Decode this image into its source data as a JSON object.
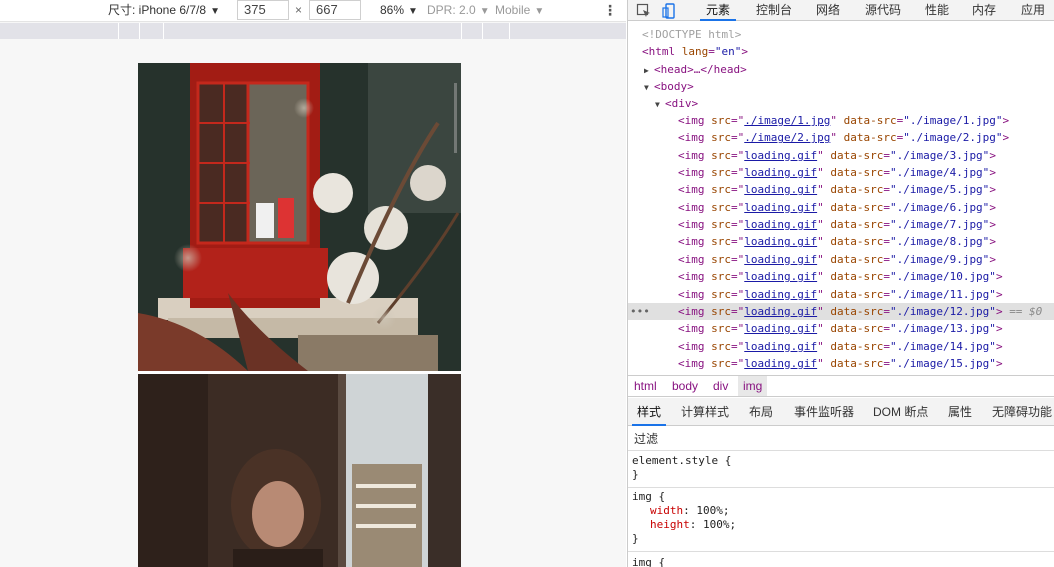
{
  "device_toolbar": {
    "device_label": "尺寸: iPhone 6/7/8",
    "width": "375",
    "times": "×",
    "height": "667",
    "zoom": "86%",
    "dpr": "DPR: 2.0",
    "mode": "Mobile",
    "more_icon": "kebab-menu-icon"
  },
  "devtools": {
    "tabs": [
      "元素",
      "控制台",
      "网络",
      "源代码",
      "性能",
      "内存",
      "应用"
    ],
    "active_tab": "元素",
    "toolbar_icons": [
      "inspect-element-icon",
      "device-toggle-icon"
    ],
    "accent": "#1a73e8"
  },
  "tree": {
    "doctype": "<!DOCTYPE html>",
    "html_open": "<html",
    "html_attr": "lang",
    "html_val": "\"en\"",
    "head": "<head>…</head>",
    "body": "<body>",
    "div": "<div>",
    "img_tag": "<img",
    "src_attr": "src",
    "datasrc_attr": "data-src",
    "close": ">",
    "eq_marker": "== $0",
    "imgs": [
      {
        "src": "./image/1.jpg",
        "data_src": "\"./image/1.jpg\""
      },
      {
        "src": "./image/2.jpg",
        "data_src": "\"./image/2.jpg\""
      },
      {
        "src": "loading.gif",
        "data_src": "\"./image/3.jpg\""
      },
      {
        "src": "loading.gif",
        "data_src": "\"./image/4.jpg\""
      },
      {
        "src": "loading.gif",
        "data_src": "\"./image/5.jpg\""
      },
      {
        "src": "loading.gif",
        "data_src": "\"./image/6.jpg\""
      },
      {
        "src": "loading.gif",
        "data_src": "\"./image/7.jpg\""
      },
      {
        "src": "loading.gif",
        "data_src": "\"./image/8.jpg\""
      },
      {
        "src": "loading.gif",
        "data_src": "\"./image/9.jpg\""
      },
      {
        "src": "loading.gif",
        "data_src": "\"./image/10.jpg\""
      },
      {
        "src": "loading.gif",
        "data_src": "\"./image/11.jpg\""
      },
      {
        "src": "loading.gif",
        "data_src": "\"./image/12.jpg\""
      },
      {
        "src": "loading.gif",
        "data_src": "\"./image/13.jpg\""
      },
      {
        "src": "loading.gif",
        "data_src": "\"./image/14.jpg\""
      },
      {
        "src": "loading.gif",
        "data_src": "\"./image/15.jpg\""
      }
    ],
    "selected_index": 11
  },
  "breadcrumb": [
    "html",
    "body",
    "div",
    "img"
  ],
  "panel_tabs": [
    "样式",
    "计算样式",
    "布局",
    "事件监听器",
    "DOM 断点",
    "属性",
    "无障碍功能"
  ],
  "active_panel_tab": "样式",
  "filter": {
    "placeholder": "过滤"
  },
  "styles": {
    "element_style": "element.style {",
    "close_brace": "}",
    "img_selector": "img {",
    "props": [
      {
        "name": "width",
        "value": "100%;"
      },
      {
        "name": "height",
        "value": "100%;"
      }
    ],
    "img_selector_2": "img {"
  }
}
